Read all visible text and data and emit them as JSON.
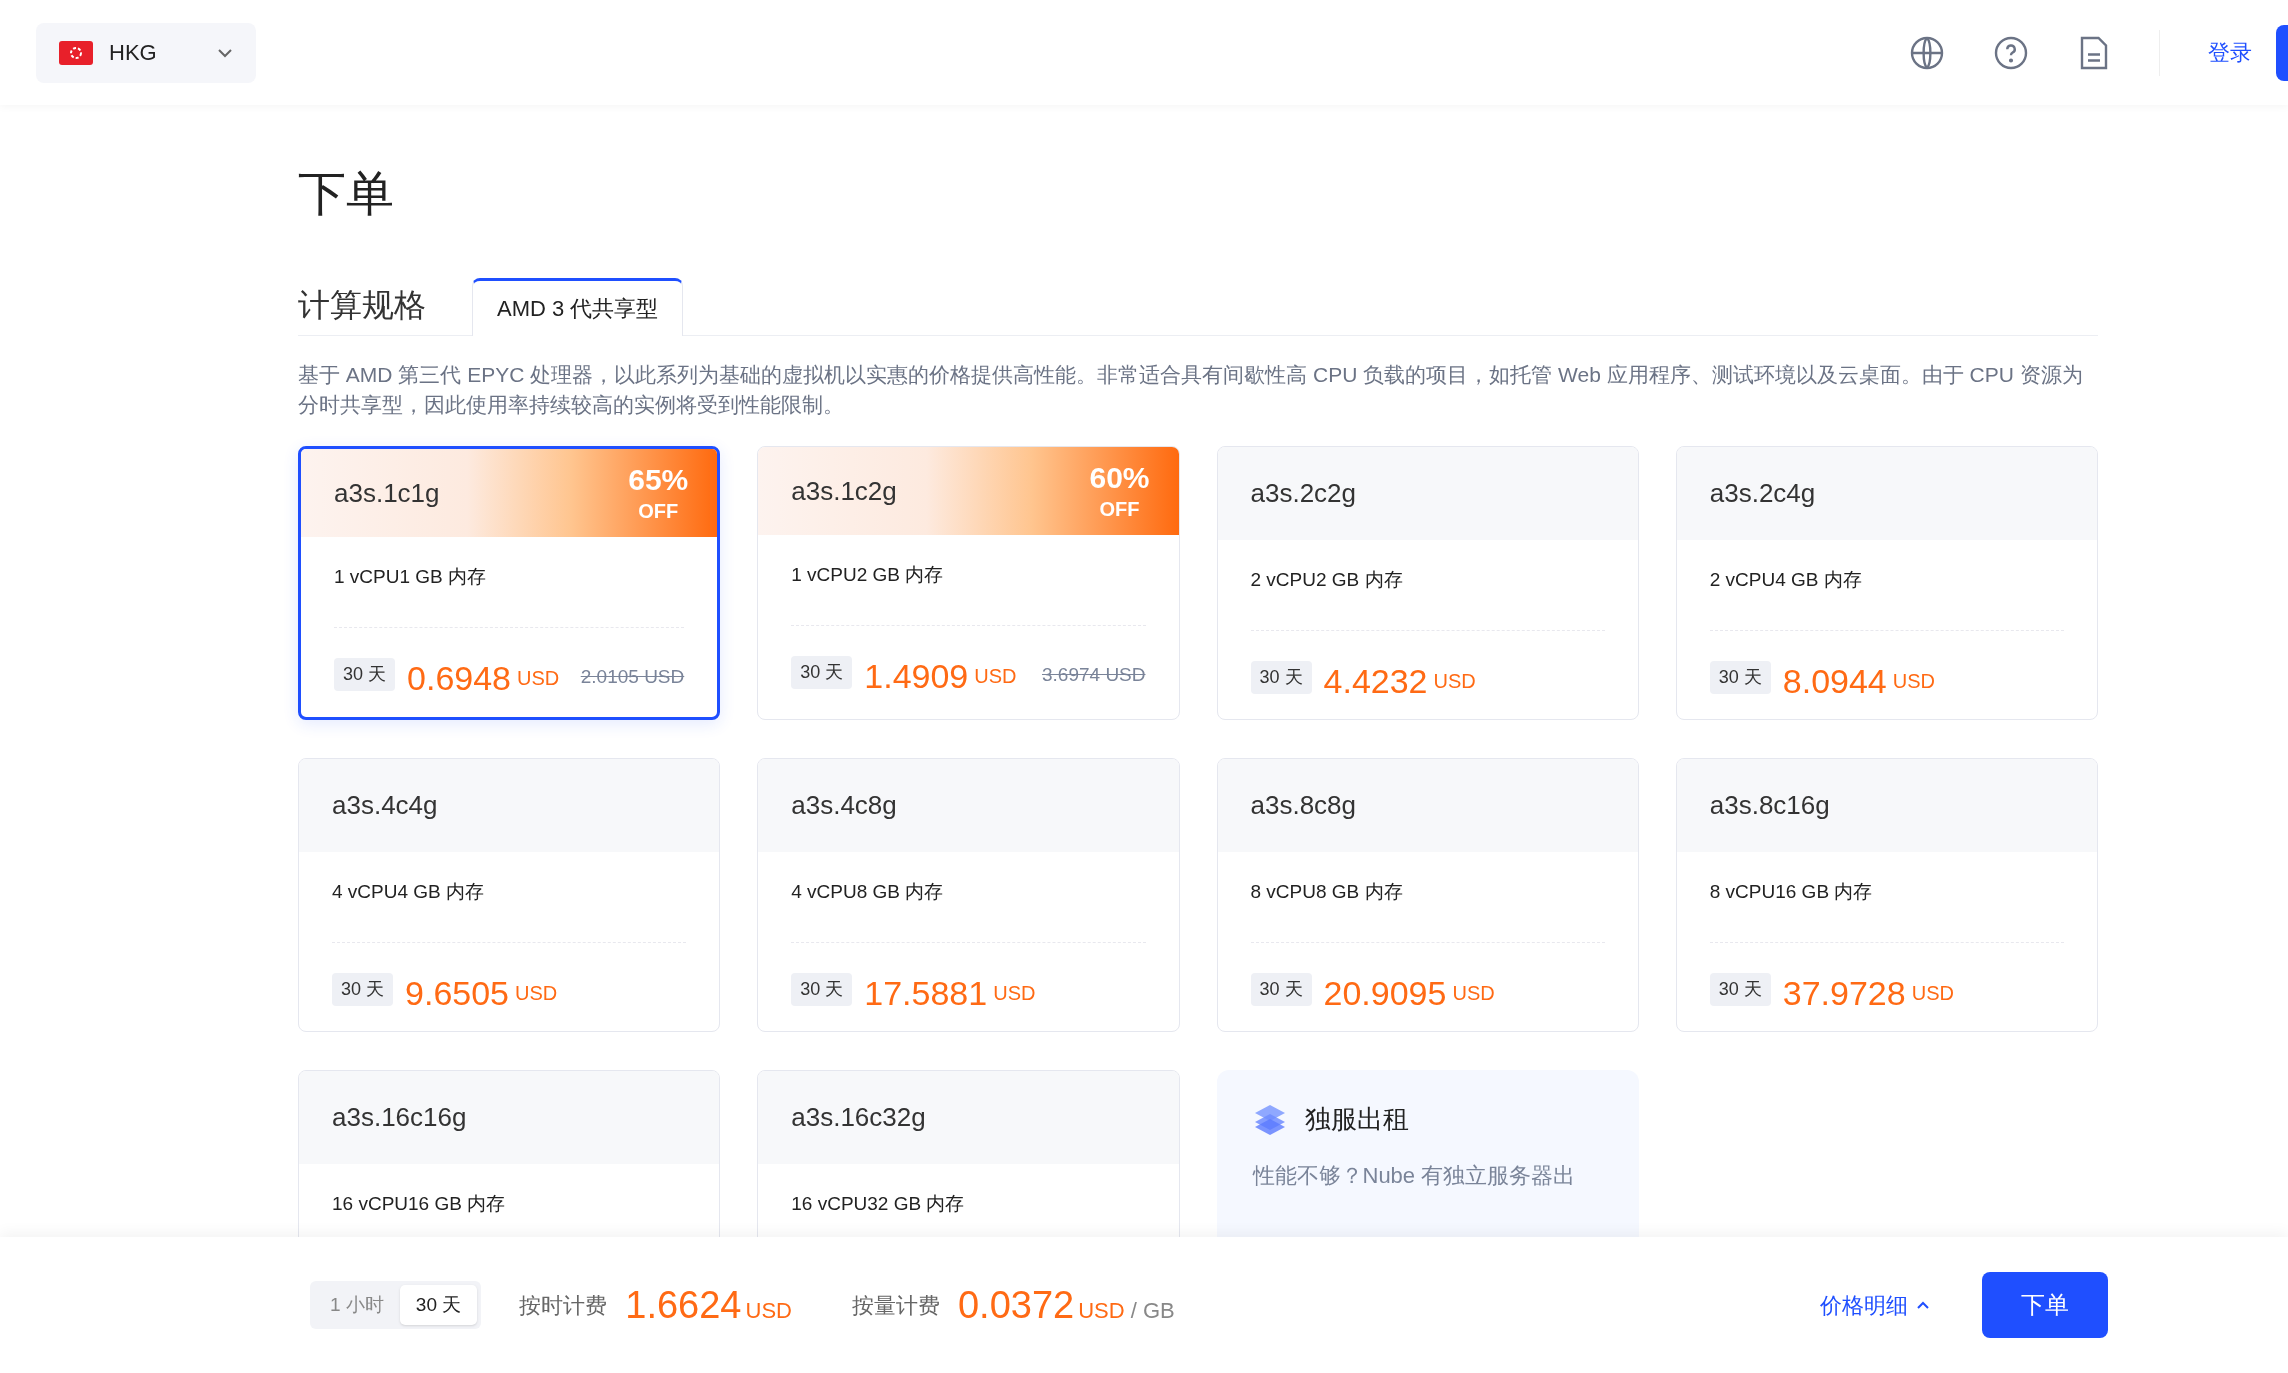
{
  "header": {
    "region": {
      "code": "HKG"
    },
    "login": "登录"
  },
  "title": "下单",
  "section": {
    "label": "计算规格",
    "tabs": [
      {
        "label": "AMD 3 代共享型",
        "selected": true
      }
    ]
  },
  "description": "基于 AMD 第三代 EPYC 处理器，以此系列为基础的虚拟机以实惠的价格提供高性能。非常适合具有间歇性高 CPU 负载的项目，如托管 Web 应用程序、测试环境以及云桌面。由于 CPU 资源为分时共享型，因此使用率持续较高的实例将受到性能限制。",
  "plans": [
    {
      "name": "a3s.1c1g",
      "spec": "1 vCPU1 GB 内存",
      "period": "30 天",
      "price": "0.6948",
      "currency": "USD",
      "original_price": "2.0105 USD",
      "discount": {
        "percent": "65%",
        "off": "OFF"
      },
      "selected": true
    },
    {
      "name": "a3s.1c2g",
      "spec": "1 vCPU2 GB 内存",
      "period": "30 天",
      "price": "1.4909",
      "currency": "USD",
      "original_price": "3.6974 USD",
      "discount": {
        "percent": "60%",
        "off": "OFF"
      },
      "selected": false
    },
    {
      "name": "a3s.2c2g",
      "spec": "2 vCPU2 GB 内存",
      "period": "30 天",
      "price": "4.4232",
      "currency": "USD",
      "selected": false
    },
    {
      "name": "a3s.2c4g",
      "spec": "2 vCPU4 GB 内存",
      "period": "30 天",
      "price": "8.0944",
      "currency": "USD",
      "selected": false
    },
    {
      "name": "a3s.4c4g",
      "spec": "4 vCPU4 GB 内存",
      "period": "30 天",
      "price": "9.6505",
      "currency": "USD",
      "selected": false
    },
    {
      "name": "a3s.4c8g",
      "spec": "4 vCPU8 GB 内存",
      "period": "30 天",
      "price": "17.5881",
      "currency": "USD",
      "selected": false
    },
    {
      "name": "a3s.8c8g",
      "spec": "8 vCPU8 GB 内存",
      "period": "30 天",
      "price": "20.9095",
      "currency": "USD",
      "selected": false
    },
    {
      "name": "a3s.8c16g",
      "spec": "8 vCPU16 GB 内存",
      "period": "30 天",
      "price": "37.9728",
      "currency": "USD",
      "selected": false
    },
    {
      "name": "a3s.16c16g",
      "spec": "16 vCPU16 GB 内存",
      "selected": false
    },
    {
      "name": "a3s.16c32g",
      "spec": "16 vCPU32 GB 内存",
      "selected": false
    }
  ],
  "promo": {
    "title": "独服出租",
    "text": "性能不够？Nube 有独立服务器出"
  },
  "footer": {
    "billing_toggle": [
      {
        "label": "1 小时",
        "selected": false
      },
      {
        "label": "30 天",
        "selected": true
      }
    ],
    "hourly": {
      "label": "按时计费",
      "price": "1.6624",
      "unit": "USD"
    },
    "usage": {
      "label": "按量计费",
      "price": "0.0372",
      "unit": "USD",
      "suffix": "/ GB"
    },
    "details_link": "价格明细",
    "order_button": "下单"
  }
}
